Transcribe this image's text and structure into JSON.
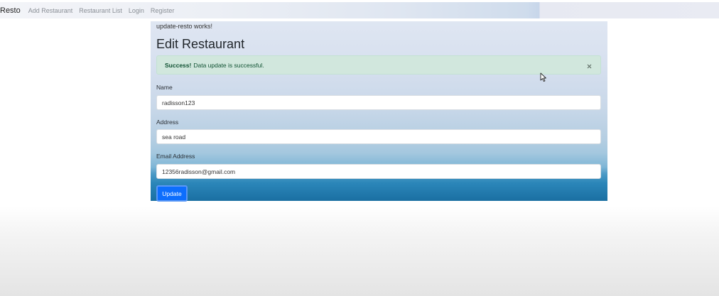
{
  "navbar": {
    "brand": "Resto",
    "links": [
      {
        "label": "Add Restaurant"
      },
      {
        "label": "Restaurant List"
      },
      {
        "label": "Login"
      },
      {
        "label": "Register"
      }
    ]
  },
  "page": {
    "works_text": "update-resto works!",
    "title": "Edit Restaurant"
  },
  "alert": {
    "strong": "Success!",
    "message": "Data update is successful.",
    "close_icon": "close-icon"
  },
  "form": {
    "name": {
      "label": "Name",
      "value": "radisson123"
    },
    "address": {
      "label": "Address",
      "value": "sea road"
    },
    "email": {
      "label": "Email Address",
      "value": "12356radisson@gmail.com"
    },
    "submit_label": "Update"
  },
  "colors": {
    "primary": "#0d6efd",
    "alert_bg": "#d1e7dd",
    "alert_text": "#0f5132"
  }
}
